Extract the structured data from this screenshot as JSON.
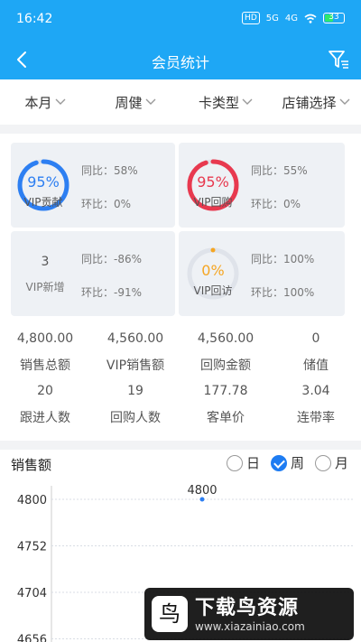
{
  "status": {
    "time": "16:42",
    "hd": "HD",
    "sig1": "5G",
    "sig2": "4G",
    "battery": "33"
  },
  "nav": {
    "title": "会员统计"
  },
  "filters": [
    {
      "label": "本月"
    },
    {
      "label": "周健"
    },
    {
      "label": "卡类型"
    },
    {
      "label": "店铺选择"
    }
  ],
  "cards": [
    {
      "value": "95%",
      "label": "VIP贡献",
      "yoy": "同比：58%",
      "mom": "环比：0%",
      "ring": 0.95,
      "color": "#2d7ff2"
    },
    {
      "value": "95%",
      "label": "VIP回购",
      "yoy": "同比：55%",
      "mom": "环比：0%",
      "ring": 0.95,
      "color": "#e8394f"
    },
    {
      "value": "3",
      "label": "VIP新增",
      "yoy": "同比：-86%",
      "mom": "环比：-91%"
    },
    {
      "value": "0%",
      "label": "VIP回访",
      "yoy": "同比：100%",
      "mom": "环比：100%",
      "ring": 0,
      "color": "#f5a623"
    }
  ],
  "metrics": [
    [
      {
        "v": "4,800.00"
      },
      {
        "v": "4,560.00"
      },
      {
        "v": "4,560.00"
      },
      {
        "v": "0"
      }
    ],
    [
      {
        "v": "销售总额"
      },
      {
        "v": "VIP销售额"
      },
      {
        "v": "回购金额"
      },
      {
        "v": "储值"
      }
    ],
    [
      {
        "v": "20"
      },
      {
        "v": "19"
      },
      {
        "v": "177.78"
      },
      {
        "v": "3.04"
      }
    ],
    [
      {
        "v": "跟进人数"
      },
      {
        "v": "回购人数"
      },
      {
        "v": "客单价"
      },
      {
        "v": "连带率"
      }
    ]
  ],
  "chart": {
    "title": "销售额",
    "periods": [
      {
        "label": "日",
        "checked": false
      },
      {
        "label": "周",
        "checked": true
      },
      {
        "label": "月",
        "checked": false
      }
    ]
  },
  "chart_data": {
    "type": "line",
    "x": [
      0
    ],
    "values": [
      4800
    ],
    "y_ticks": [
      "4800",
      "4752",
      "4704",
      "4656"
    ],
    "data_labels": [
      "4800"
    ],
    "ylim": [
      4656,
      4800
    ],
    "grid": true
  },
  "watermark": {
    "title": "下载鸟资源",
    "url": "www.xiazainiao.com",
    "logo": "鸟"
  }
}
